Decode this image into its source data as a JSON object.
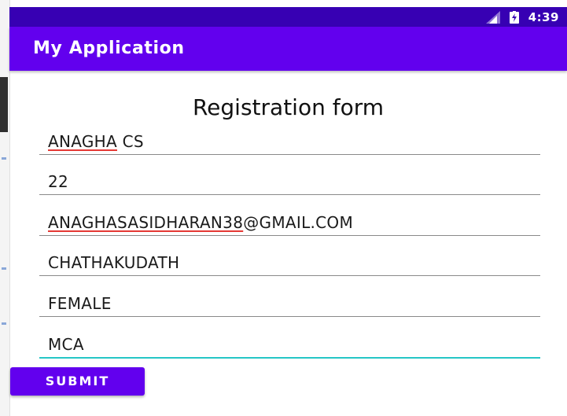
{
  "status_bar": {
    "time": "4:39",
    "icons": [
      "signal-icon",
      "battery-charging-icon"
    ],
    "color": "#3700b3"
  },
  "app_bar": {
    "title": "My Application",
    "color": "#6200ee"
  },
  "form": {
    "title": "Registration form",
    "fields": [
      {
        "name": "name",
        "value_marked": "ANAGHA",
        "value_rest": " CS"
      },
      {
        "name": "age",
        "value": "22"
      },
      {
        "name": "email",
        "value_marked": "ANAGHASASIDHARAN38",
        "value_rest": "@GMAIL.COM"
      },
      {
        "name": "address",
        "value": "CHATHAKUDATH"
      },
      {
        "name": "gender",
        "value": "FEMALE"
      },
      {
        "name": "course",
        "value": "MCA"
      }
    ],
    "focused_underline_color": "#26c6c6",
    "submit_label": "SUBMIT"
  }
}
